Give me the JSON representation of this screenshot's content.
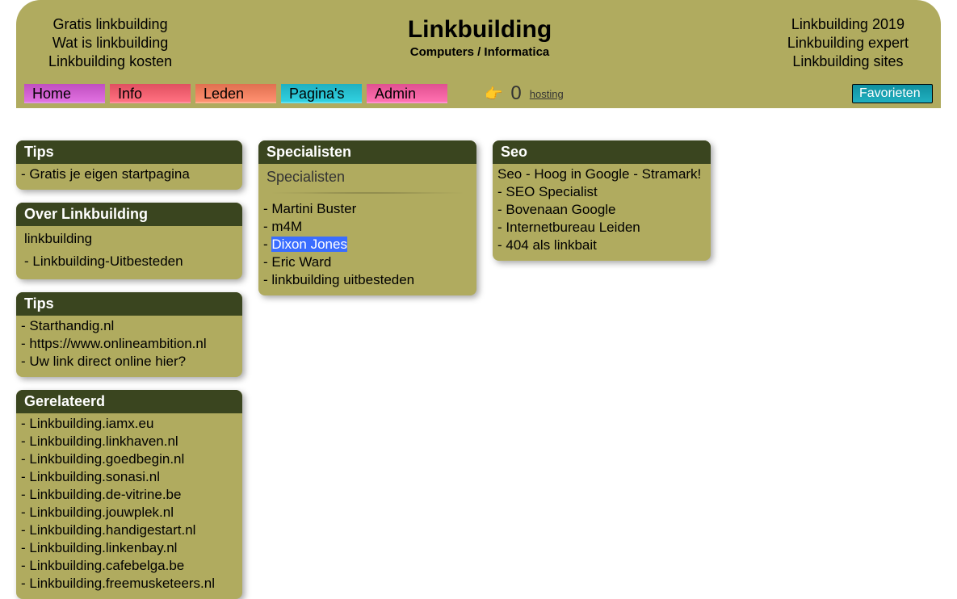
{
  "header": {
    "left": [
      "Gratis linkbuilding",
      "Wat is linkbuilding",
      "Linkbuilding kosten"
    ],
    "title": "Linkbuilding",
    "subtitle": "Computers / Informatica",
    "right": [
      "Linkbuilding 2019",
      "Linkbuilding expert",
      "Linkbuilding sites"
    ]
  },
  "nav": {
    "home": "Home",
    "info": "Info",
    "leden": "Leden",
    "pagina": "Pagina's",
    "admin": "Admin",
    "icon": "👉",
    "count": "0",
    "hosting": "hosting",
    "favorieten": "Favorieten"
  },
  "boxes": {
    "tips1": {
      "title": "Tips",
      "items": [
        "Gratis je eigen startpagina"
      ]
    },
    "over": {
      "title": "Over Linkbuilding",
      "items": [
        "linkbuilding",
        "Linkbuilding-Uitbesteden"
      ]
    },
    "tips2": {
      "title": "Tips",
      "items": [
        "Starthandig.nl",
        "https://www.onlineambition.nl",
        "Uw link direct online hier?"
      ]
    },
    "gerelateerd": {
      "title": "Gerelateerd",
      "items": [
        "Linkbuilding.iamx.eu",
        "Linkbuilding.linkhaven.nl",
        "Linkbuilding.goedbegin.nl",
        "Linkbuilding.sonasi.nl",
        "Linkbuilding.de-vitrine.be",
        "Linkbuilding.jouwplek.nl",
        "Linkbuilding.handigestart.nl",
        "Linkbuilding.linkenbay.nl",
        "Linkbuilding.cafebelga.be",
        "Linkbuilding.freemusketeers.nl"
      ]
    },
    "specialisten": {
      "title": "Specialisten",
      "sublabel": "Specialisten",
      "items": [
        "Martini Buster",
        "m4M",
        "Dixon Jones",
        "Eric Ward",
        "linkbuilding uitbesteden"
      ],
      "selectedIndex": 2
    },
    "seo": {
      "title": "Seo",
      "items": [
        "Seo - Hoog in Google - Stramark!",
        "SEO Specialist",
        "Bovenaan Google",
        "Internetbureau Leiden",
        "404 als linkbait"
      ]
    }
  }
}
